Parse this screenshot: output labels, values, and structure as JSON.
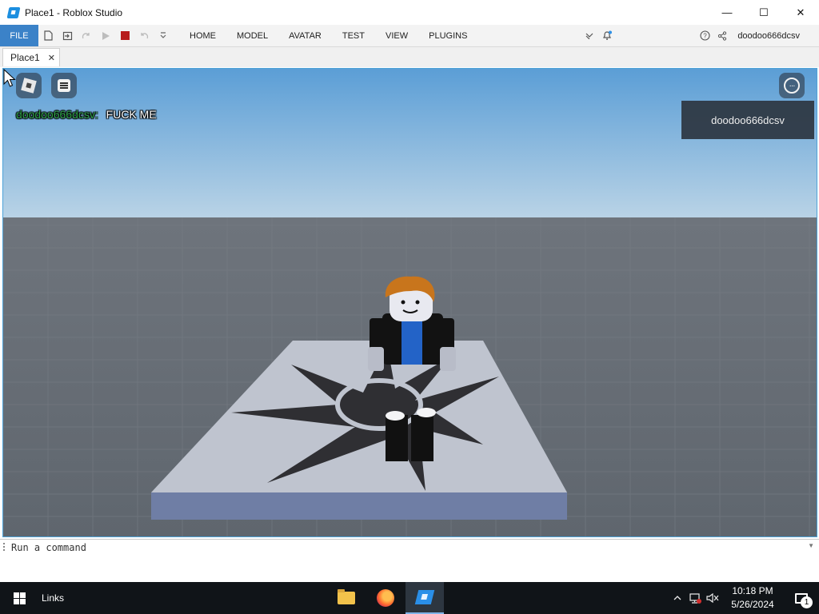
{
  "window": {
    "title": "Place1 - Roblox Studio",
    "controls": {
      "minimize": "—",
      "maximize": "☐",
      "close": "✕"
    }
  },
  "menubar": {
    "file_label": "FILE",
    "tabs": [
      "HOME",
      "MODEL",
      "AVATAR",
      "TEST",
      "VIEW",
      "PLUGINS"
    ],
    "quick_access_icons": [
      "new-file-icon",
      "import-icon",
      "redo-icon",
      "play-icon",
      "stop-icon",
      "undo-icon",
      "customize-icon"
    ],
    "username": "doodoo666dcsv"
  },
  "doc_tabs": [
    {
      "label": "Place1",
      "close": "✕"
    }
  ],
  "viewport": {
    "chat": {
      "user": "doodoo666dcsv:",
      "message": "FUCK ME"
    },
    "player_list": [
      "doodoo666dcsv"
    ]
  },
  "command_bar": {
    "placeholder": "Run a command"
  },
  "taskbar": {
    "links_label": "Links",
    "time": "10:18 PM",
    "date": "5/26/2024",
    "notification_count": "1",
    "accent": "#7eb3e8"
  },
  "colors": {
    "file_button": "#3b82c8",
    "viewport_border": "#4ea3d8",
    "chat_username": "#2fa34a",
    "stop_button": "#b71c1c"
  }
}
